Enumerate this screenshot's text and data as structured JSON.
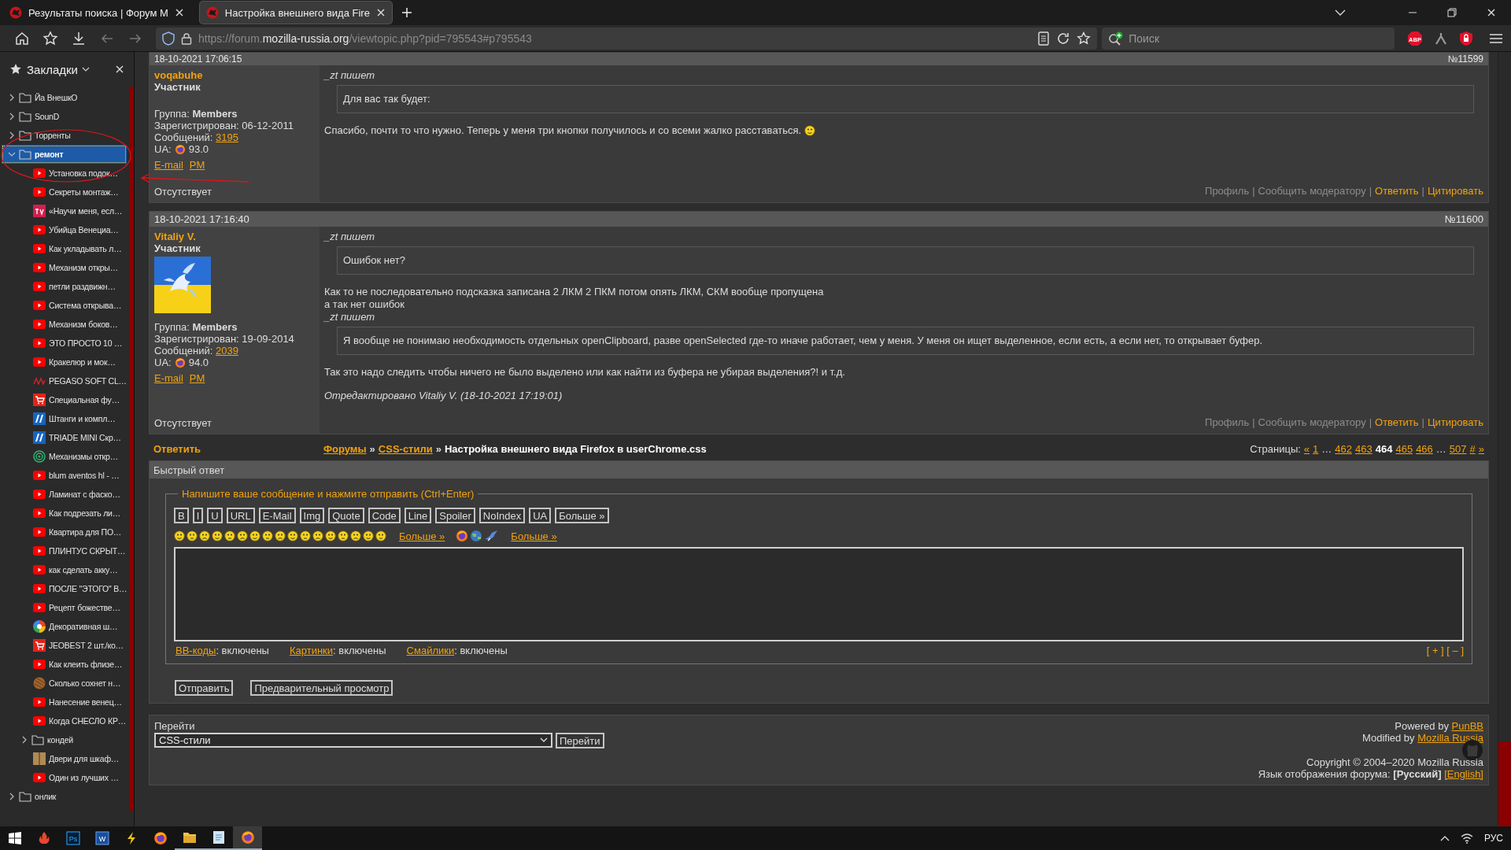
{
  "browser_tabs": [
    {
      "title": "Результаты поиска | Форум M",
      "selected": false
    },
    {
      "title": "Настройка внешнего вида Fire",
      "selected": true
    }
  ],
  "address": {
    "parts": [
      "https://forum.",
      "mozilla-russia.org",
      "/viewtopic.php?pid=795543#p795543"
    ]
  },
  "search": {
    "placeholder": "Поиск"
  },
  "extensions": [
    {
      "kind": "abp",
      "label": "ABP"
    },
    {
      "kind": "tool"
    },
    {
      "kind": "shield"
    }
  ],
  "sidebar": {
    "title": "Закладки",
    "items": [
      {
        "title": "Йа ВнешкО",
        "kind": "folder",
        "expanded": false,
        "selected": false
      },
      {
        "title": "SounD",
        "kind": "folder",
        "expanded": false,
        "selected": false
      },
      {
        "title": "Торренты",
        "kind": "folder",
        "expanded": false,
        "selected": false
      },
      {
        "title": "ремонт",
        "kind": "folder",
        "expanded": true,
        "selected": true,
        "children": [
          {
            "title": "Установка подок…",
            "kind": "video",
            "selected": false
          },
          {
            "title": "Секреты монтаж…",
            "kind": "video",
            "selected": false
          },
          {
            "title": "«Научи меня, есл…",
            "kind": "tv",
            "selected": false
          },
          {
            "title": "Убийца Венециа…",
            "kind": "video",
            "selected": false
          },
          {
            "title": "Как укладывать л…",
            "kind": "video",
            "selected": false
          },
          {
            "title": "Механизм откры…",
            "kind": "video",
            "selected": false
          },
          {
            "title": "петли раздвижн…",
            "kind": "video",
            "selected": false
          },
          {
            "title": "Система открыва…",
            "kind": "video",
            "selected": false
          },
          {
            "title": "Механизм боков…",
            "kind": "video",
            "selected": false
          },
          {
            "title": "ЭТО ПРОСТО 10 …",
            "kind": "video",
            "selected": false
          },
          {
            "title": "Кракелюр и мок…",
            "kind": "video",
            "selected": false
          },
          {
            "title": "PEGASO SOFT CL…",
            "kind": "zigzag",
            "selected": false
          },
          {
            "title": "Специальная фу…",
            "kind": "shop",
            "selected": false
          },
          {
            "title": "Штанги и компл…",
            "kind": "stripes",
            "selected": false
          },
          {
            "title": "TRIADE MINI Скр…",
            "kind": "stripes",
            "selected": false
          },
          {
            "title": "Механизмы откр…",
            "kind": "target",
            "selected": false
          },
          {
            "title": "blum aventos hl - …",
            "kind": "video",
            "selected": false
          },
          {
            "title": "Ламинат с фаско…",
            "kind": "video",
            "selected": false
          },
          {
            "title": "Как подрезать ли…",
            "kind": "video",
            "selected": false
          },
          {
            "title": "Квартира для ПО…",
            "kind": "video",
            "selected": false
          },
          {
            "title": "ПЛИНТУС СКРЫТ…",
            "kind": "video",
            "selected": false
          },
          {
            "title": "как сделать акку…",
            "kind": "video",
            "selected": false
          },
          {
            "title": "ПОСЛЕ \"ЭТОГО\" В…",
            "kind": "video",
            "selected": false
          },
          {
            "title": "Рецепт божестве…",
            "kind": "video",
            "selected": false
          },
          {
            "title": "Декоративная ш…",
            "kind": "wheel",
            "selected": false
          },
          {
            "title": "JEOBEST 2 шт./ко…",
            "kind": "shop",
            "selected": false
          },
          {
            "title": "Как клеить флизе…",
            "kind": "video",
            "selected": false
          },
          {
            "title": "Сколько сохнет н…",
            "kind": "wood",
            "selected": false
          },
          {
            "title": "Нанесение венец…",
            "kind": "video",
            "selected": false
          },
          {
            "title": "Когда СНЕСЛО КР…",
            "kind": "video",
            "selected": false
          },
          {
            "title": "кондей",
            "kind": "folder",
            "expanded": false,
            "selected": false
          },
          {
            "title": "Двери для шкаф…",
            "kind": "door",
            "selected": false
          },
          {
            "title": "Один из лучших …",
            "kind": "video",
            "selected": false
          }
        ]
      },
      {
        "title": "онлик",
        "kind": "folder",
        "expanded": false,
        "selected": false
      }
    ]
  },
  "posts": [
    {
      "date": "18-10-2021 17:06:15",
      "number": "№11599",
      "author": "voqabuhe",
      "role": "Участник",
      "group": "Группа: **Members**",
      "registered": "Зарегистрирован: 06-12-2011",
      "messages_label": "Сообщений:",
      "messages": "3195",
      "ua_label": "UA:",
      "ua": "93.0",
      "email": "E-mail",
      "pm": "PM",
      "status": "Отсутствует",
      "body": [
        {
          "kind": "attribution",
          "text": "_zt пишет"
        },
        {
          "kind": "quote",
          "text": "Для вас так будет:"
        },
        {
          "kind": "text",
          "text": "Спасибо, почти то что нужно. Теперь у меня три кнопки получилось и со всеми жалко расставаться.",
          "smiley": true
        }
      ],
      "actions": [
        {
          "kind": "muted",
          "text": "Профиль"
        },
        {
          "kind": "sep",
          "text": "|"
        },
        {
          "kind": "muted",
          "text": "Сообщить модератору"
        },
        {
          "kind": "sep",
          "text": "|"
        },
        {
          "kind": "link",
          "text": "Ответить"
        },
        {
          "kind": "sep",
          "text": "|"
        },
        {
          "kind": "link",
          "text": "Цитировать"
        }
      ]
    },
    {
      "date": "18-10-2021 17:16:40",
      "number": "№11600",
      "author": "Vitaliy V.",
      "role": "Участник",
      "avatar": {
        "kind": "picture"
      },
      "group": "Группа: **Members**",
      "registered": "Зарегистрирован: 19-09-2014",
      "messages_label": "Сообщений:",
      "messages": "2039",
      "ua_label": "UA:",
      "ua": "94.0",
      "email": "E-mail",
      "pm": "PM",
      "status": "Отсутствует",
      "body": [
        {
          "kind": "attribution",
          "text": "_zt пишет"
        },
        {
          "kind": "quote",
          "text": "Ошибок нет?"
        },
        {
          "kind": "text",
          "text": "Как то не последовательно подсказка записана 2 ЛКМ 2 ПКМ потом опять ЛКМ, СКМ вообще пропущена"
        },
        {
          "kind": "line",
          "text": "а так нет ошибок"
        },
        {
          "kind": "attribution",
          "text": "_zt пишет"
        },
        {
          "kind": "quote",
          "text": "Я вообще не понимаю необходимость отдельных openClipboard, разве openSelected где-то иначе работает, чем у меня. У меня он ищет выделенное, если есть, а если нет, то открывает буфер."
        },
        {
          "kind": "text",
          "text": "Так это надо следить чтобы ничего не было выделено или как найти из буфера не убирая выделения?! и т.д."
        },
        {
          "kind": "edited",
          "text": "Отредактировано Vitaliy V. (18-10-2021 17:19:01)"
        }
      ],
      "actions": [
        {
          "kind": "muted",
          "text": "Профиль"
        },
        {
          "kind": "sep",
          "text": "|"
        },
        {
          "kind": "muted",
          "text": "Сообщить модератору"
        },
        {
          "kind": "sep",
          "text": "|"
        },
        {
          "kind": "link",
          "text": "Ответить"
        },
        {
          "kind": "sep",
          "text": "|"
        },
        {
          "kind": "link",
          "text": "Цитировать"
        }
      ]
    }
  ],
  "topic_bar": {
    "reply": "Ответить",
    "path": [
      {
        "kind": "link",
        "text": "Форумы"
      },
      {
        "kind": "text",
        "text": "»"
      },
      {
        "kind": "link",
        "text": "CSS-стили"
      },
      {
        "kind": "text",
        "text": "»"
      },
      {
        "kind": "current",
        "text": "Настройка внешнего вида Firefox в userChrome.css"
      }
    ],
    "pages_label": "Страницы:",
    "pages": [
      {
        "kind": "link",
        "text": "«"
      },
      {
        "kind": "link",
        "text": "1"
      },
      {
        "kind": "text",
        "text": "…"
      },
      {
        "kind": "link",
        "text": "462"
      },
      {
        "kind": "link",
        "text": "463"
      },
      {
        "kind": "current",
        "text": "464"
      },
      {
        "kind": "link",
        "text": "465"
      },
      {
        "kind": "link",
        "text": "466"
      },
      {
        "kind": "text",
        "text": "…"
      },
      {
        "kind": "link",
        "text": "507"
      },
      {
        "kind": "link",
        "text": "#"
      },
      {
        "kind": "link",
        "text": "»"
      }
    ]
  },
  "quick_reply": {
    "title": "Быстрый ответ",
    "legend": "Напишите ваше сообщение и нажмите отправить (Ctrl+Enter)",
    "format_buttons": [
      "B",
      "I",
      "U",
      "URL",
      "E-Mail",
      "Img",
      "Quote",
      "Code",
      "Line",
      "Spoiler",
      "NoIndex",
      "UA",
      "Больше »"
    ],
    "more_smileys": "Больше »",
    "more_icons": "Больше »",
    "settings": [
      {
        "link": "ВВ-коды",
        "value": ": включены"
      },
      {
        "link": "Картинки",
        "value": ": включены"
      },
      {
        "link": "Смайлики",
        "value": ": включены"
      }
    ],
    "resize": "[ + ] [ – ]",
    "buttons": [
      "Отправить",
      "Предварительный просмотр"
    ]
  },
  "footer": {
    "jump_label": "Перейти",
    "jump_value": "CSS-стили",
    "jump_button": "Перейти",
    "powered_by": {
      "text": "Powered by",
      "link": "PunBB"
    },
    "modified_by": {
      "text": "Modified by",
      "link": "Mozilla Russia"
    },
    "copyright": "Copyright © 2004–2020 Mozilla Russia",
    "language": {
      "label": "Язык отображения форума:",
      "current": "[Русский]",
      "other": "[English]"
    }
  },
  "taskbar": {
    "apps": [
      {
        "kind": "flame",
        "open": false,
        "selected": false
      },
      {
        "kind": "ps",
        "label": "Ps",
        "open": false,
        "selected": false
      },
      {
        "kind": "word",
        "label": "W",
        "open": false,
        "selected": false
      },
      {
        "kind": "bolt",
        "open": false,
        "selected": false
      },
      {
        "kind": "firefox",
        "open": false,
        "selected": false
      },
      {
        "kind": "folder",
        "open": true,
        "selected": false
      },
      {
        "kind": "notepad",
        "open": true,
        "selected": false
      },
      {
        "kind": "firefox",
        "open": true,
        "selected": true
      }
    ],
    "language": "РУС"
  }
}
